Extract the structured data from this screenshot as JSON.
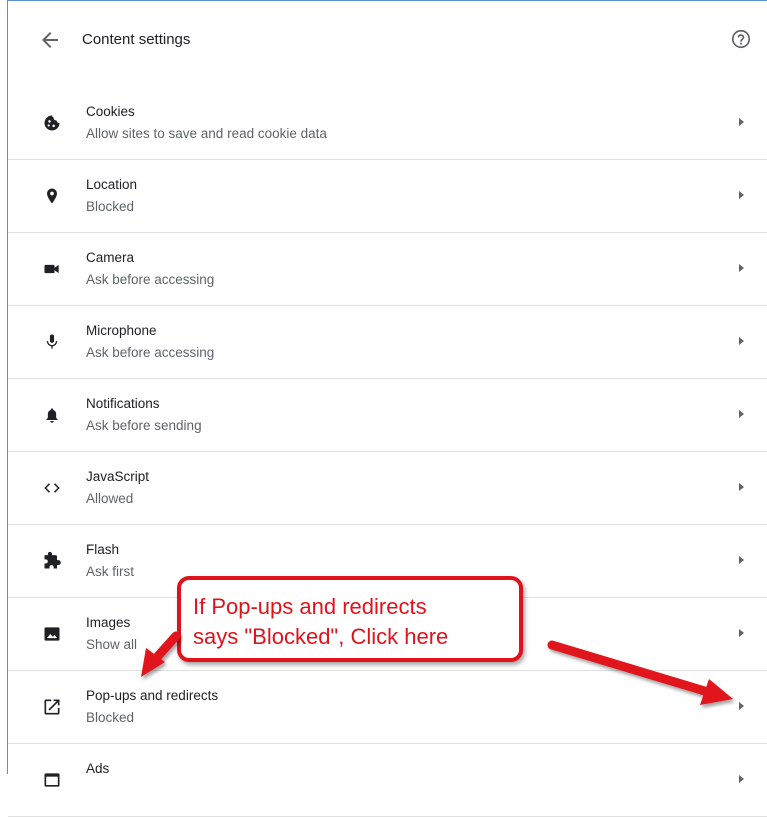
{
  "header": {
    "title": "Content settings",
    "back_icon": "arrow-back-icon",
    "help_icon": "help-icon"
  },
  "settings": [
    {
      "label": "Cookies",
      "subtitle": "Allow sites to save and read cookie data",
      "icon": "cookie-icon"
    },
    {
      "label": "Location",
      "subtitle": "Blocked",
      "icon": "location-pin-icon"
    },
    {
      "label": "Camera",
      "subtitle": "Ask before accessing",
      "icon": "camera-icon"
    },
    {
      "label": "Microphone",
      "subtitle": "Ask before accessing",
      "icon": "microphone-icon"
    },
    {
      "label": "Notifications",
      "subtitle": "Ask before sending",
      "icon": "bell-icon"
    },
    {
      "label": "JavaScript",
      "subtitle": "Allowed",
      "icon": "code-icon"
    },
    {
      "label": "Flash",
      "subtitle": "Ask first",
      "icon": "puzzle-icon"
    },
    {
      "label": "Images",
      "subtitle": "Show all",
      "icon": "image-icon"
    },
    {
      "label": "Pop-ups and redirects",
      "subtitle": "Blocked",
      "icon": "open-in-new-icon"
    },
    {
      "label": "Ads",
      "subtitle": "",
      "icon": "ads-icon"
    }
  ],
  "annotation": {
    "line1": "If Pop-ups and redirects",
    "line2": "says \"Blocked\", Click here",
    "color": "#e0131c"
  }
}
